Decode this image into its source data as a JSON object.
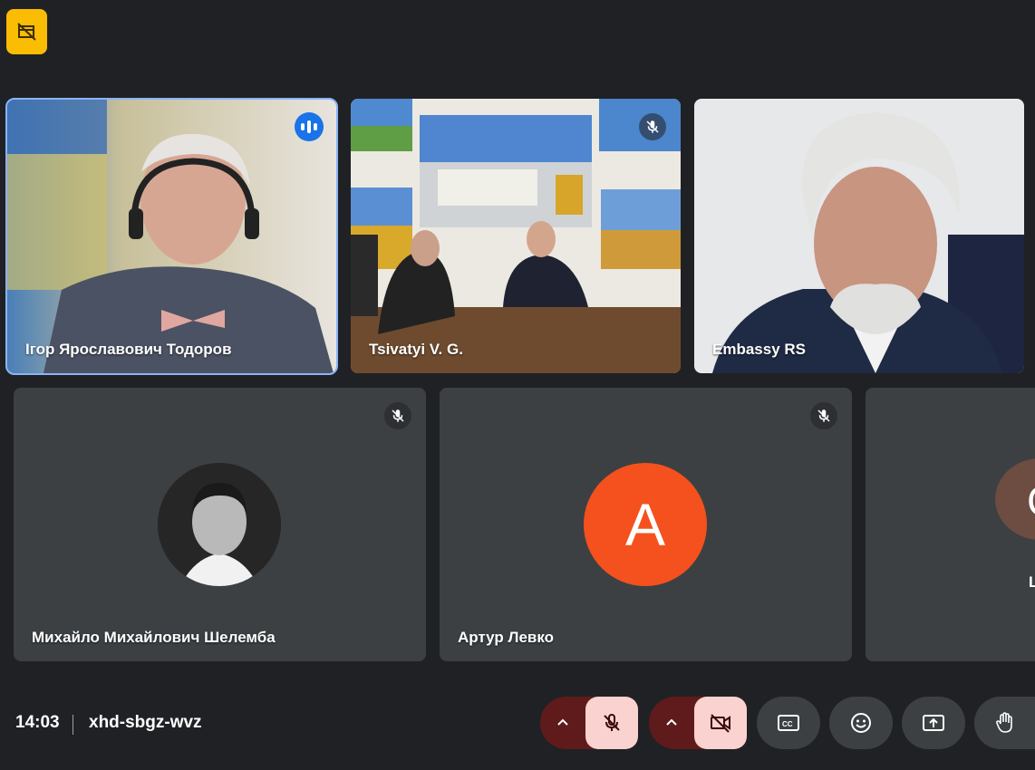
{
  "participants": {
    "tile1": {
      "name": "Ігор Ярославович Тодоров"
    },
    "tile2": {
      "name": "Tsivatyi V. G."
    },
    "tile3": {
      "name": "Embassy RS"
    },
    "tile4": {
      "name": "Михайло Михайлович Шелемба"
    },
    "tile5": {
      "name": "Артур Левко",
      "avatar_letter": "A",
      "avatar_color": "#f4511e"
    },
    "tile6": {
      "name_partial": "L",
      "avatar_letter_partial": "C",
      "avatar_color": "#6d4c41"
    }
  },
  "bottom_bar": {
    "time": "14:03",
    "meeting_code": "xhd-sbgz-wvz"
  },
  "colors": {
    "background": "#202124",
    "tile_bg": "#3c4043",
    "speaking_outline": "#8ab4f8",
    "badge_yellow": "#fbbc04",
    "control_danger_bg": "#5f1b1b",
    "control_danger_fg": "#fad2cf"
  },
  "icons": {
    "top_badge": "no-streaming-icon",
    "mic": "mic-off-icon",
    "camera": "videocam-off-icon",
    "captions": "closed-caption-icon",
    "reactions": "emoji-icon",
    "present": "present-screen-icon",
    "raise_hand": "hand-icon"
  }
}
